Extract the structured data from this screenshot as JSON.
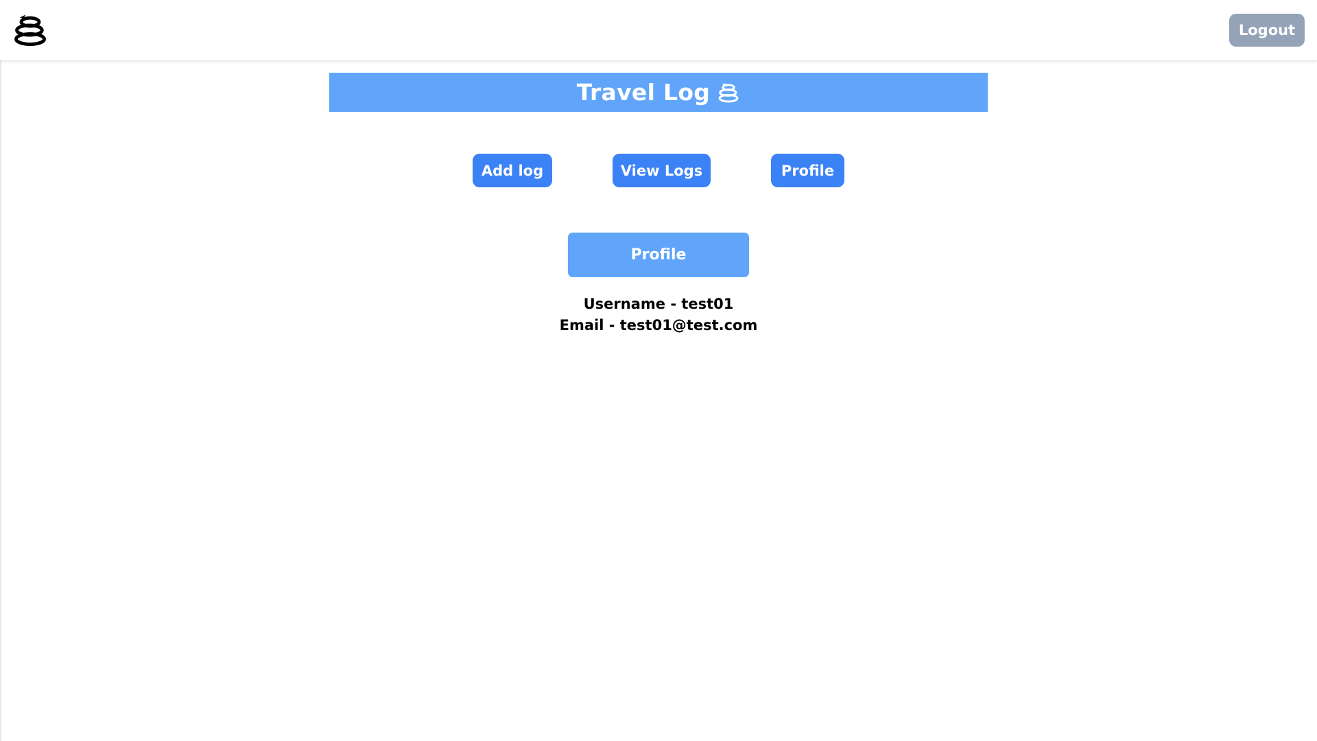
{
  "navbar": {
    "logo_icon": "travel-log-logo-icon",
    "logout_label": "Logout",
    "logout_color": "#94a3b8"
  },
  "banner": {
    "title": "Travel Log",
    "icon": "travel-log-logo-icon",
    "color": "#60a5fa"
  },
  "actions": {
    "add_log_label": "Add log",
    "view_logs_label": "View Logs",
    "profile_label": "Profile",
    "color": "#3b82f6"
  },
  "profile": {
    "header": "Profile",
    "username_line": "Username - test01",
    "email_line": "Email - test01@test.com"
  }
}
